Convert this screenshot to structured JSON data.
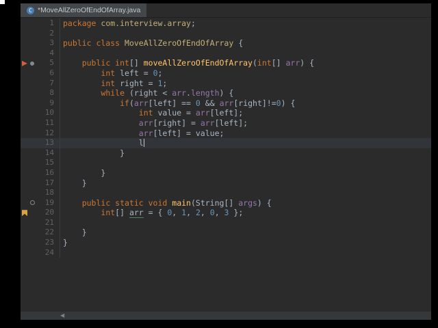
{
  "tab_bar": {
    "tabs": [
      {
        "title": "*MoveAllZeroOfEndOfArray.java",
        "icon": "java-class-icon",
        "icon_letter": "C",
        "active": true,
        "modified": true
      }
    ]
  },
  "editor": {
    "current_line": 13,
    "total_lines": 24,
    "palette": {
      "background": "#2b2b2b",
      "current_line_bg": "#313438",
      "lineno": "#606366",
      "keyword": "#cc7832",
      "plain": "#a9b7c6",
      "classref": "#c3b176",
      "method": "#ffc66d",
      "number": "#6897bb",
      "param": "#9876aa",
      "caret": "#c8c8c8"
    },
    "gutter_markers": [
      {
        "line": 5,
        "slot": 0,
        "type": "breakpoint-icon",
        "shape": "triangle",
        "color": "#d2603e"
      },
      {
        "line": 5,
        "slot": 1,
        "type": "run-marker-icon",
        "shape": "dot",
        "color": "#7f8b91"
      },
      {
        "line": 19,
        "slot": 1,
        "type": "run-marker-icon",
        "shape": "ring",
        "color": "#7f8b91"
      },
      {
        "line": 20,
        "slot": 0,
        "type": "bookmark-icon",
        "shape": "flag",
        "color": "#d9a343"
      }
    ],
    "lines": [
      {
        "n": 1,
        "tokens": [
          [
            "package ",
            "k"
          ],
          [
            "com.interview.array",
            "c"
          ],
          [
            ";",
            "p"
          ]
        ]
      },
      {
        "n": 2,
        "tokens": []
      },
      {
        "n": 3,
        "tokens": [
          [
            "public class ",
            "k"
          ],
          [
            "MoveAllZeroOfEndOfArray",
            "c"
          ],
          [
            " {",
            "p"
          ]
        ]
      },
      {
        "n": 4,
        "tokens": []
      },
      {
        "n": 5,
        "tokens": [
          [
            "    ",
            "p"
          ],
          [
            "public int",
            "k"
          ],
          [
            "[] ",
            "p"
          ],
          [
            "moveAllZeroOfEndOfArray",
            "m"
          ],
          [
            "(",
            "p"
          ],
          [
            "int",
            "k"
          ],
          [
            "[] ",
            "p"
          ],
          [
            "arr",
            "a"
          ],
          [
            ") {",
            "p"
          ]
        ]
      },
      {
        "n": 6,
        "tokens": [
          [
            "        ",
            "p"
          ],
          [
            "int ",
            "k"
          ],
          [
            "left = ",
            "p"
          ],
          [
            "0",
            "n"
          ],
          [
            ";",
            "p"
          ]
        ]
      },
      {
        "n": 7,
        "tokens": [
          [
            "        ",
            "p"
          ],
          [
            "int ",
            "k"
          ],
          [
            "right = ",
            "p"
          ],
          [
            "1",
            "n"
          ],
          [
            ";",
            "p"
          ]
        ]
      },
      {
        "n": 8,
        "tokens": [
          [
            "        ",
            "p"
          ],
          [
            "while ",
            "k"
          ],
          [
            "(right < ",
            "p"
          ],
          [
            "arr",
            "a"
          ],
          [
            ".",
            "p"
          ],
          [
            "length",
            "a"
          ],
          [
            ") {",
            "p"
          ]
        ]
      },
      {
        "n": 9,
        "tokens": [
          [
            "            ",
            "p"
          ],
          [
            "if",
            "k"
          ],
          [
            "(",
            "p"
          ],
          [
            "arr",
            "a"
          ],
          [
            "[left] == ",
            "p"
          ],
          [
            "0",
            "n"
          ],
          [
            " && ",
            "p"
          ],
          [
            "arr",
            "a"
          ],
          [
            "[right]!=",
            "p"
          ],
          [
            "0",
            "n"
          ],
          [
            ") {",
            "p"
          ]
        ]
      },
      {
        "n": 10,
        "tokens": [
          [
            "                ",
            "p"
          ],
          [
            "int ",
            "k"
          ],
          [
            "value = ",
            "p"
          ],
          [
            "arr",
            "a"
          ],
          [
            "[left];",
            "p"
          ]
        ]
      },
      {
        "n": 11,
        "tokens": [
          [
            "                ",
            "p"
          ],
          [
            "arr",
            "a"
          ],
          [
            "[right] = ",
            "p"
          ],
          [
            "arr",
            "a"
          ],
          [
            "[left];",
            "p"
          ]
        ]
      },
      {
        "n": 12,
        "tokens": [
          [
            "                ",
            "p"
          ],
          [
            "arr",
            "a"
          ],
          [
            "[left] = value;",
            "p"
          ]
        ]
      },
      {
        "n": 13,
        "tokens": [
          [
            "                ",
            "p"
          ],
          [
            "l",
            "p"
          ]
        ],
        "caret": true
      },
      {
        "n": 14,
        "tokens": [
          [
            "            }",
            "p"
          ]
        ]
      },
      {
        "n": 15,
        "tokens": []
      },
      {
        "n": 16,
        "tokens": [
          [
            "        }",
            "p"
          ]
        ]
      },
      {
        "n": 17,
        "tokens": [
          [
            "    }",
            "p"
          ]
        ]
      },
      {
        "n": 18,
        "tokens": []
      },
      {
        "n": 19,
        "tokens": [
          [
            "    ",
            "p"
          ],
          [
            "public static void ",
            "k"
          ],
          [
            "main",
            "m"
          ],
          [
            "(String[] ",
            "p"
          ],
          [
            "args",
            "a"
          ],
          [
            ") {",
            "p"
          ]
        ]
      },
      {
        "n": 20,
        "tokens": [
          [
            "        ",
            "p"
          ],
          [
            "int",
            "k"
          ],
          [
            "[] ",
            "p"
          ],
          [
            "arr",
            "u"
          ],
          [
            " = { ",
            "p"
          ],
          [
            "0",
            "n"
          ],
          [
            ", ",
            "p"
          ],
          [
            "1",
            "n"
          ],
          [
            ", ",
            "p"
          ],
          [
            "2",
            "n"
          ],
          [
            ", ",
            "p"
          ],
          [
            "0",
            "n"
          ],
          [
            ", ",
            "p"
          ],
          [
            "3",
            "n"
          ],
          [
            " };",
            "p"
          ]
        ]
      },
      {
        "n": 21,
        "tokens": []
      },
      {
        "n": 22,
        "tokens": [
          [
            "    }",
            "p"
          ]
        ]
      },
      {
        "n": 23,
        "tokens": [
          [
            "}",
            "p"
          ]
        ]
      },
      {
        "n": 24,
        "tokens": []
      }
    ]
  },
  "scrollbar": {
    "left_arrow": "◀"
  }
}
